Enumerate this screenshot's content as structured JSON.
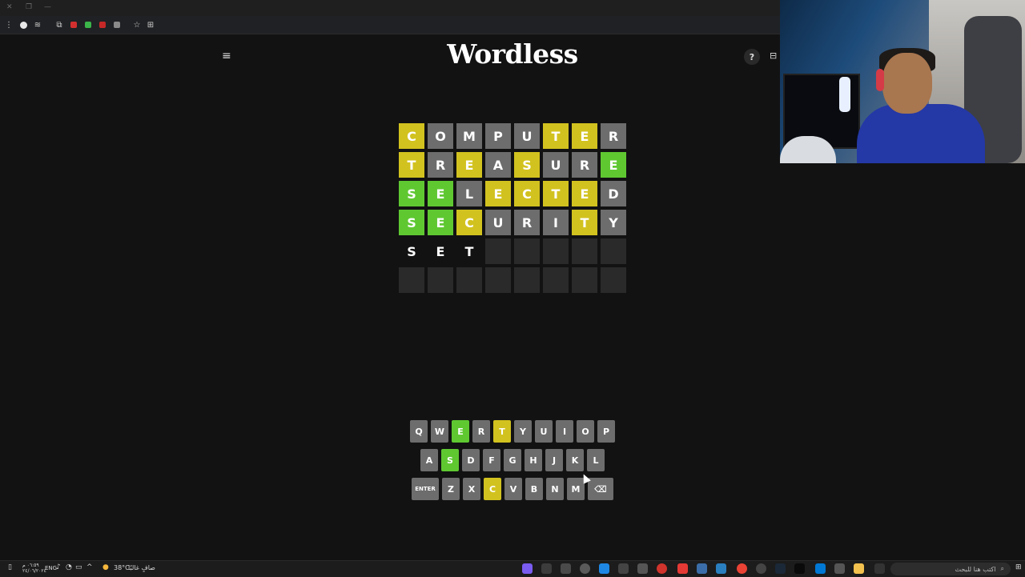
{
  "app": {
    "title": "Wordless"
  },
  "board": {
    "rows": [
      [
        {
          "l": "C",
          "s": "y"
        },
        {
          "l": "O",
          "s": "x"
        },
        {
          "l": "M",
          "s": "x"
        },
        {
          "l": "P",
          "s": "x"
        },
        {
          "l": "U",
          "s": "x"
        },
        {
          "l": "T",
          "s": "y"
        },
        {
          "l": "E",
          "s": "y"
        },
        {
          "l": "R",
          "s": "x"
        }
      ],
      [
        {
          "l": "T",
          "s": "y"
        },
        {
          "l": "R",
          "s": "x"
        },
        {
          "l": "E",
          "s": "y"
        },
        {
          "l": "A",
          "s": "x"
        },
        {
          "l": "S",
          "s": "y"
        },
        {
          "l": "U",
          "s": "x"
        },
        {
          "l": "R",
          "s": "x"
        },
        {
          "l": "E",
          "s": "g"
        }
      ],
      [
        {
          "l": "S",
          "s": "g"
        },
        {
          "l": "E",
          "s": "g"
        },
        {
          "l": "L",
          "s": "x"
        },
        {
          "l": "E",
          "s": "y"
        },
        {
          "l": "C",
          "s": "y"
        },
        {
          "l": "T",
          "s": "y"
        },
        {
          "l": "E",
          "s": "y"
        },
        {
          "l": "D",
          "s": "x"
        }
      ],
      [
        {
          "l": "S",
          "s": "g"
        },
        {
          "l": "E",
          "s": "g"
        },
        {
          "l": "C",
          "s": "y"
        },
        {
          "l": "U",
          "s": "x"
        },
        {
          "l": "R",
          "s": "x"
        },
        {
          "l": "I",
          "s": "x"
        },
        {
          "l": "T",
          "s": "y"
        },
        {
          "l": "Y",
          "s": "x"
        }
      ],
      [
        {
          "l": "S",
          "s": "t"
        },
        {
          "l": "E",
          "s": "t"
        },
        {
          "l": "T",
          "s": "t"
        },
        {
          "l": "",
          "s": "e"
        },
        {
          "l": "",
          "s": "e"
        },
        {
          "l": "",
          "s": "e"
        },
        {
          "l": "",
          "s": "e"
        },
        {
          "l": "",
          "s": "e"
        }
      ],
      [
        {
          "l": "",
          "s": "e"
        },
        {
          "l": "",
          "s": "e"
        },
        {
          "l": "",
          "s": "e"
        },
        {
          "l": "",
          "s": "e"
        },
        {
          "l": "",
          "s": "e"
        },
        {
          "l": "",
          "s": "e"
        },
        {
          "l": "",
          "s": "e"
        },
        {
          "l": "",
          "s": "e"
        }
      ]
    ]
  },
  "keyboard": {
    "rows": [
      [
        {
          "k": "Q"
        },
        {
          "k": "W"
        },
        {
          "k": "E",
          "s": "g"
        },
        {
          "k": "R"
        },
        {
          "k": "T",
          "s": "y"
        },
        {
          "k": "Y"
        },
        {
          "k": "U"
        },
        {
          "k": "I"
        },
        {
          "k": "O"
        },
        {
          "k": "P"
        }
      ],
      [
        {
          "k": "A"
        },
        {
          "k": "S",
          "s": "g"
        },
        {
          "k": "D"
        },
        {
          "k": "F"
        },
        {
          "k": "G"
        },
        {
          "k": "H"
        },
        {
          "k": "J"
        },
        {
          "k": "K"
        },
        {
          "k": "L"
        }
      ],
      [
        {
          "k": "ENTER",
          "wide": true
        },
        {
          "k": "Z"
        },
        {
          "k": "X"
        },
        {
          "k": "C",
          "s": "y"
        },
        {
          "k": "V"
        },
        {
          "k": "B"
        },
        {
          "k": "N"
        },
        {
          "k": "M"
        },
        {
          "k": "⌫",
          "back": true
        }
      ]
    ]
  },
  "colors": {
    "correct": "#5fc831",
    "present": "#d2c21f",
    "absent": "#6d6d6d",
    "empty": "#2a2a2b",
    "bg": "#121213"
  },
  "icons": {
    "menu": "≡",
    "help": "?",
    "calendar": "⊟",
    "backspace": "⌫"
  },
  "taskbar": {
    "weather": "38°C",
    "weather_text": "صافٍ غالبًا",
    "lang": "ENG",
    "time": "٠٦:٥٩ م",
    "date": "٢٤/٠٦/٢٠٢٤",
    "search_placeholder": "اكتب هنا للبحث"
  }
}
